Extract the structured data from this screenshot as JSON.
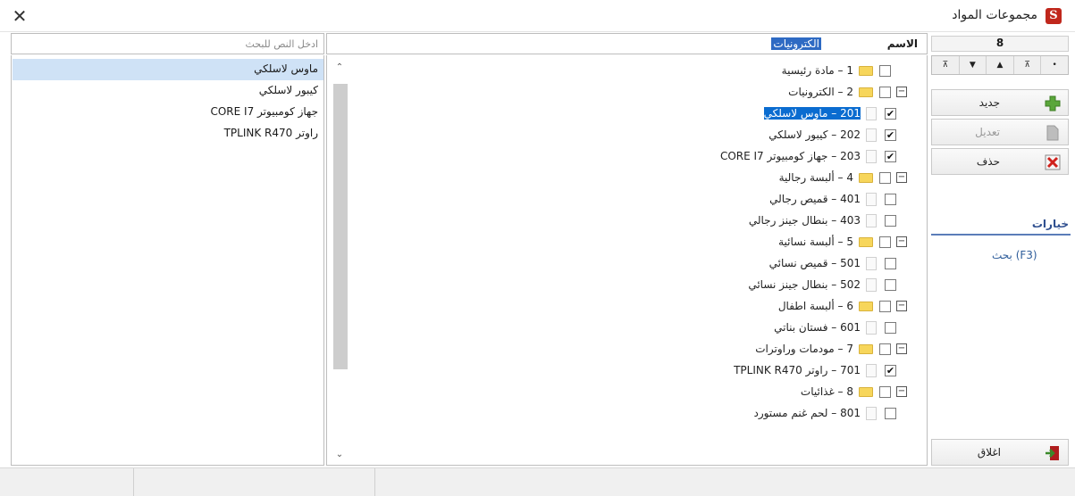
{
  "window": {
    "title": "مجموعات المواد",
    "logo_letter": "S",
    "close_glyph": "✕"
  },
  "search": {
    "placeholder": "ادخل النص للبحث",
    "value": ""
  },
  "tree_header": {
    "column": "الاسم",
    "selected_text": "الكترونيات"
  },
  "nav": {
    "count": "8",
    "buttons": [
      "•",
      "⊼",
      "▲",
      "▼",
      "⊼"
    ]
  },
  "actions": {
    "new": "جديد",
    "edit": "تعديل",
    "delete": "حذف",
    "close": "اغلاق"
  },
  "options": {
    "title": "خيارات",
    "search": "بحث  (F3)"
  },
  "tree": [
    {
      "text": "1 – مادة رئيسية",
      "level": 0,
      "expander": "",
      "checked": false
    },
    {
      "text": "2 – الكترونيات",
      "level": 0,
      "expander": "⊟",
      "checked": false
    },
    {
      "text": "201 – ماوس لاسلكي",
      "level": 1,
      "expander": "",
      "checked": true,
      "selected": true
    },
    {
      "text": "202 – كيبور لاسلكي",
      "level": 1,
      "expander": "",
      "checked": true
    },
    {
      "text": "203 – جهاز كومبيوتر CORE I7",
      "level": 1,
      "expander": "",
      "checked": true
    },
    {
      "text": "4 – ألبسة رجالية",
      "level": 0,
      "expander": "⊟",
      "checked": false
    },
    {
      "text": "401 – قميص رجالي",
      "level": 1,
      "expander": "",
      "checked": false
    },
    {
      "text": "403 – بنطال جينز رجالي",
      "level": 1,
      "expander": "",
      "checked": false
    },
    {
      "text": "5 – ألبسة نسائية",
      "level": 0,
      "expander": "⊟",
      "checked": false
    },
    {
      "text": "501 – قميص نسائي",
      "level": 1,
      "expander": "",
      "checked": false
    },
    {
      "text": "502 – بنطال جينز نسائي",
      "level": 1,
      "expander": "",
      "checked": false
    },
    {
      "text": "6 – ألبسة اطفال",
      "level": 0,
      "expander": "⊟",
      "checked": false
    },
    {
      "text": "601 – فستان بناتي",
      "level": 1,
      "expander": "",
      "checked": false
    },
    {
      "text": "7 – مودمات وراوترات",
      "level": 0,
      "expander": "⊟",
      "checked": false
    },
    {
      "text": "701 – راوتر TPLINK R470",
      "level": 1,
      "expander": "",
      "checked": true
    },
    {
      "text": "8 – غذائيات",
      "level": 0,
      "expander": "⊟",
      "checked": false
    },
    {
      "text": "801 – لحم غنم مستورد",
      "level": 1,
      "expander": "",
      "checked": false
    }
  ],
  "results": [
    "ماوس لاسلكي",
    "كيبور لاسلكي",
    "جهاز كومبيوتر CORE I7",
    "راوتر TPLINK R470"
  ],
  "colors": {
    "accent": "#2e6ac3",
    "selection": "#0a6cd0",
    "logo": "#c0271c"
  }
}
